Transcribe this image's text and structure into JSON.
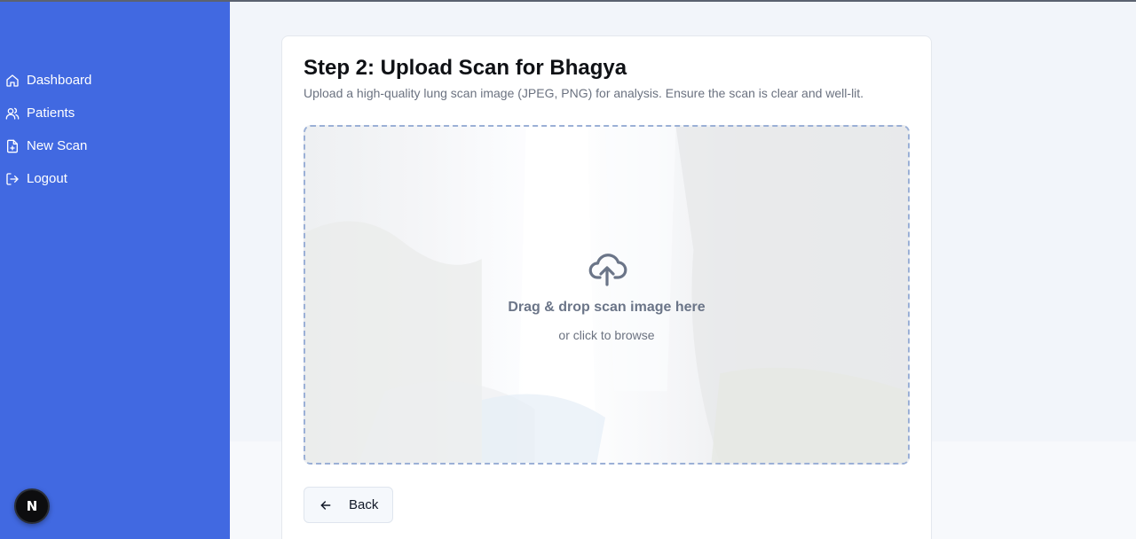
{
  "sidebar": {
    "items": [
      {
        "label": "Dashboard",
        "icon": "home-icon"
      },
      {
        "label": "Patients",
        "icon": "users-icon"
      },
      {
        "label": "New Scan",
        "icon": "file-plus-icon"
      },
      {
        "label": "Logout",
        "icon": "logout-icon"
      }
    ],
    "badge": "N",
    "bg_color": "#4169e1"
  },
  "upload": {
    "title": "Step 2: Upload Scan for Bhagya",
    "subtitle": "Upload a high-quality lung scan image (JPEG, PNG) for analysis. Ensure the scan is clear and well-lit.",
    "dropzone_title": "Drag & drop scan image here",
    "dropzone_sub": "or click to browse",
    "dropzone_icon": "upload-cloud-icon",
    "back_label": "Back",
    "back_icon": "arrow-left-icon"
  }
}
